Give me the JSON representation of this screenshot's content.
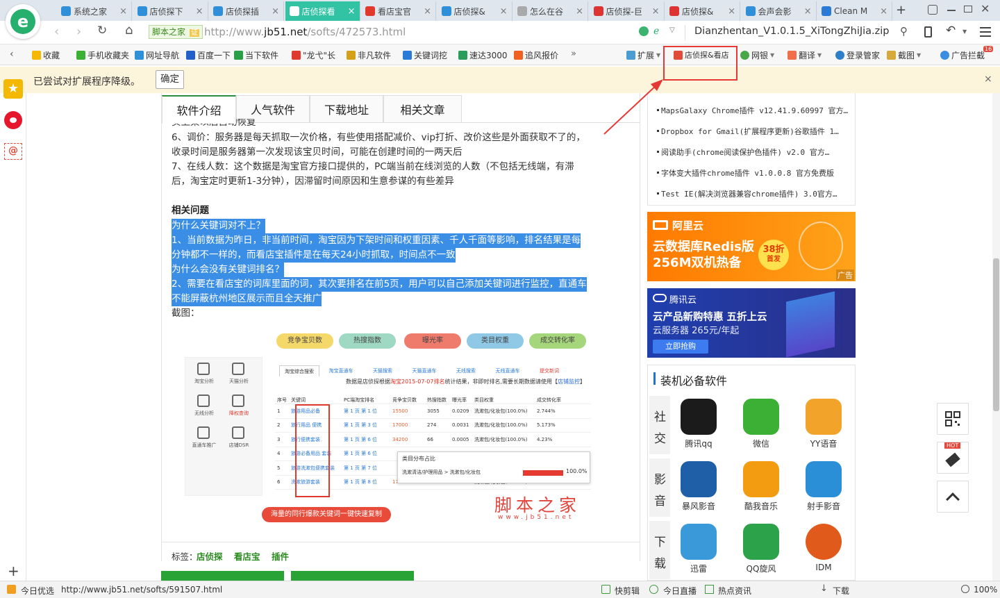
{
  "tabs": [
    {
      "label": "系统之家",
      "icon_color": "#2f8fd8",
      "active": false
    },
    {
      "label": "店侦探下",
      "icon_color": "#2f8fd8",
      "active": false
    },
    {
      "label": "店侦探插",
      "icon_color": "#2f8fd8",
      "active": false
    },
    {
      "label": "店侦探看",
      "icon_color": "#ffffff",
      "active": true
    },
    {
      "label": "看店宝官",
      "icon_color": "#e03a2f",
      "active": false
    },
    {
      "label": "店侦探&",
      "icon_color": "#2f8fd8",
      "active": false
    },
    {
      "label": "怎么在谷",
      "icon_color": "#aaaaaa",
      "active": false
    },
    {
      "label": "店侦探-巨",
      "icon_color": "#d33",
      "active": false
    },
    {
      "label": "店侦探&",
      "icon_color": "#d33",
      "active": false
    },
    {
      "label": "会声会影",
      "icon_color": "#2f8fd8",
      "active": false
    },
    {
      "label": "Clean M",
      "icon_color": "#2a7bd8",
      "active": false
    }
  ],
  "address": {
    "site_badge": "脚本之家",
    "cert": "证",
    "url_prefix": "http://www.",
    "url_domain": "jb51.net",
    "url_path": "/softs/472573.html",
    "download_name": "Dianzhentan_V1.0.1.5_XiTongZhiJia.zip"
  },
  "bookmarks": [
    "收藏",
    "手机收藏夹",
    "网址导航",
    "百度一下",
    "当下软件",
    "\"龙弋\"长",
    "非凡软件",
    "关键词挖",
    "速达3000",
    "追风报价"
  ],
  "toolbar_ext": {
    "ext_label": "扩展",
    "dzt_label": "店侦探&看店",
    "wangyin": "网银",
    "fanyi": "翻译",
    "login_mgr": "登录管家",
    "screenshot": "截图",
    "adblock": "广告拦截",
    "adblock_badge": "16"
  },
  "notice": {
    "text": "已尝试对扩展程序降级。",
    "ok": "确定",
    "close": "×"
  },
  "content_tabs": [
    "软件介绍",
    "人气软件",
    "下载地址",
    "相关文章"
  ],
  "article": {
    "cut_line": "买上架以后自动恢复",
    "p6a": "6、调价：服务器是每天抓取一次价格，有些使用搭配减价、vip打折、改价这些是外面获取不了的，",
    "p6b": "收录时间是服务器第一次发现该宝贝时间，可能在创建时间的一两天后",
    "p7a": "7、在线人数：这个数据是淘宝官方接口提供的，PC端当前在线浏览的人数（不包括无线端，有滞",
    "p7b": "后，淘宝定时更新1-3分钟），因滞留时间原因和生意参谋的有些差异",
    "faq_title": "相关问题",
    "q1": "为什么关键词对不上？",
    "a1a": "1、当前数据为昨日，非当前时间，淘宝因为下架时间和权重因素、千人千面等影响，排名结果是每",
    "a1b": "分钟都不一样的，而看店宝插件是在每天24小时抓取，时间点不一致",
    "q2": "为什么会没有关键词排名？",
    "a2a": "2、需要在看店宝的词库里面的词，其次要排名在前5页，用户可以自己添加关键词进行监控，直通车",
    "a2b": "不能屏蔽杭州地区展示而且全天推广",
    "shot_label": "截图：",
    "tags_label": "标签：",
    "tags": [
      "店侦探",
      "看店宝",
      "插件"
    ]
  },
  "figure": {
    "pills": [
      "竞争宝贝数",
      "热搜指数",
      "曝光率",
      "类目权重",
      "成交转化率"
    ],
    "pill_colors": [
      "#f5d86a",
      "#9fd9c4",
      "#ef7b6d",
      "#8fc9e6",
      "#a6d67c"
    ],
    "side_items": [
      "淘宝分析",
      "天猫分析",
      "无线分析",
      "降权查询",
      "直通车推广",
      "店铺DSR"
    ],
    "inner_tabs": [
      "淘宝综合搜索",
      "淘宝直通车",
      "天猫搜索",
      "天猫直通车",
      "无线搜索",
      "无线直通车",
      "提交新词"
    ],
    "caption_pre": "数据是店侦探根据",
    "caption_red": "淘宝2015-07-07排名",
    "caption_post": "统计结果，非即时排名,需要长期数据请使用【",
    "caption_link": "店铺监控",
    "caption_end": "】",
    "headers": [
      "序号",
      "关键词",
      "PC端淘宝排名",
      "竞争宝贝数",
      "热搜指数",
      "曝光率",
      "类目权重",
      "成交转化率"
    ],
    "rows": [
      [
        "1",
        "旅游用品必备",
        "第 1 页 第 1 位",
        "15500",
        "3055",
        "0.0209",
        "洗漱包/化妆包(100.0%)",
        "2.744%"
      ],
      [
        "2",
        "旅行用品 便携",
        "第 1 页 第 3 位",
        "17000",
        "274",
        "0.0031",
        "洗漱包/化妆包(100.0%)",
        "5.173%"
      ],
      [
        "3",
        "旅行便携套装",
        "第 1 页 第 6 位",
        "34200",
        "66",
        "0.0005",
        "洗漱包/化妆包(100.0%)",
        "4.23%"
      ],
      [
        "4",
        "旅游必备用品 套装",
        "第 1 页 第 6 位",
        "",
        "",
        "",
        "",
        ""
      ],
      [
        "5",
        "旅游洗漱包便携套装",
        "第 1 页 第 7 位",
        "",
        "",
        "",
        "",
        ""
      ],
      [
        "6",
        "洗漱旅游套装",
        "第 1 页 第 8 位",
        "17800",
        "55",
        "0.0008",
        "洗漱包/化妆包(100.0%)",
        "13.56%"
      ]
    ],
    "popup_title": "类目分布占比",
    "popup_path": "洗漱清洁/护理用品 > 洗漱包/化妆包",
    "popup_pct": "100.0%",
    "watermark": "脚本之家",
    "watermark_url": "www.jb51.net",
    "bottom_banner": "海量的同行爆款关键词一键快速复制"
  },
  "sidebar_links": [
    "MapsGalaxy Chrome插件 v12.41.9.60997 官方…",
    "Dropbox for Gmail(扩展程序更新)谷歌插件 1…",
    "阅读助手(chrome阅读保护色插件) v2.0 官方…",
    "字体变大插件chrome插件 v1.0.0.8 官方免费版",
    "Test IE(解决浏览器兼容chrome插件) 3.0官方…"
  ],
  "ad1": {
    "brand": "阿里云",
    "line1": "云数据库Redis版",
    "line2": "256M双机热备",
    "badge1": "38折",
    "badge2": "首发",
    "tag": "广告"
  },
  "ad2": {
    "brand": "腾讯云",
    "line1": "云产品新购特惠 五折上云",
    "line2": "云服务器 265元/年起",
    "btn": "立即抢购"
  },
  "apps_title": "装机必备软件",
  "app_groups": [
    {
      "label_a": "社",
      "label_b": "交",
      "apps": [
        "腾讯qq",
        "微信",
        "YY语音"
      ],
      "colors": [
        "#1b1b1b",
        "#3cb034",
        "#f1a32a"
      ]
    },
    {
      "label_a": "影",
      "label_b": "音",
      "apps": [
        "暴风影音",
        "酷我音乐",
        "射手影音"
      ],
      "colors": [
        "#1e5fa8",
        "#f39c12",
        "#2a8fd6"
      ]
    },
    {
      "label_a": "下",
      "label_b": "载",
      "apps": [
        "迅雷",
        "QQ旋风",
        "IDM"
      ],
      "colors": [
        "#3a9ad9",
        "#2ca24a",
        "#e05a1c"
      ]
    }
  ],
  "right_float": {
    "hot": "HOT"
  },
  "status": {
    "left": "今日优选",
    "url": "http://www.jb51.net/softs/591507.html",
    "items": [
      "快剪辑",
      "今日直播",
      "热点资讯",
      "下载"
    ],
    "zoom": "100%"
  }
}
